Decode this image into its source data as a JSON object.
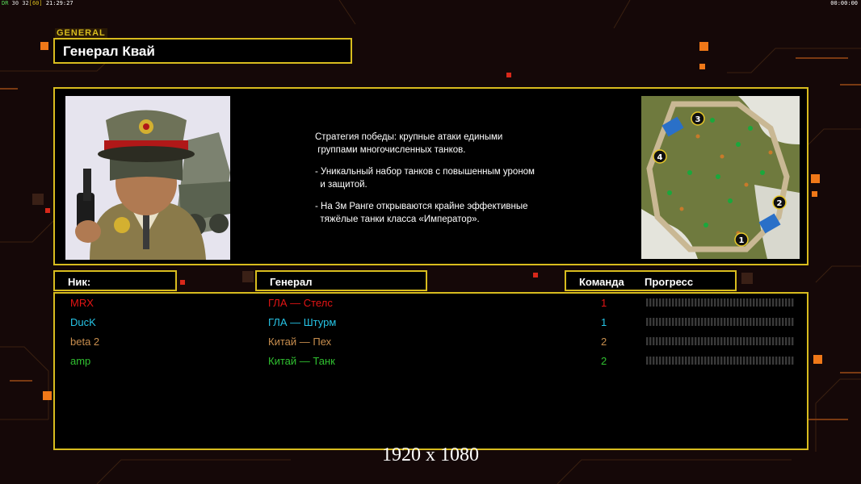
{
  "hud": {
    "left_a": "DR",
    "left_b": "30",
    "left_c": "32",
    "left_d": "[60]",
    "left_time": "21:29:27",
    "right_time": "00:00:00"
  },
  "header": {
    "tag": "GENERAL",
    "title": "Генерал Квай"
  },
  "info": {
    "description": [
      "Стратегия победы: крупные атаки едиными\n группами многочисленных танков.",
      "- Уникальный набор танков с повышенным уроном\n  и защитой.",
      "- На 3м Ранге открываются крайне эффективные\n  тяжёлые танки класса «Император»."
    ],
    "map_slots": [
      "3",
      "4",
      "2",
      "1"
    ]
  },
  "columns": {
    "nick": "Ник:",
    "general": "Генерал",
    "team": "Команда",
    "progress": "Прогресс"
  },
  "players": [
    {
      "nick": "MRX",
      "general": "ГЛА — Стелс",
      "team": "1",
      "color": "#e31414",
      "progress": 0
    },
    {
      "nick": "DucK",
      "general": "ГЛА — Штурм",
      "team": "1",
      "color": "#26c4e6",
      "progress": 0
    },
    {
      "nick": "beta 2",
      "general": "Китай — Пех",
      "team": "2",
      "color": "#c88e4e",
      "progress": 0
    },
    {
      "nick": "amp",
      "general": "Китай — Танк",
      "team": "2",
      "color": "#30c030",
      "progress": 0
    }
  ],
  "footer": {
    "resolution": "1920 x 1080"
  },
  "colors": {
    "frame": "#d8bc1e",
    "background": "#150808",
    "accent": "#f07818"
  }
}
